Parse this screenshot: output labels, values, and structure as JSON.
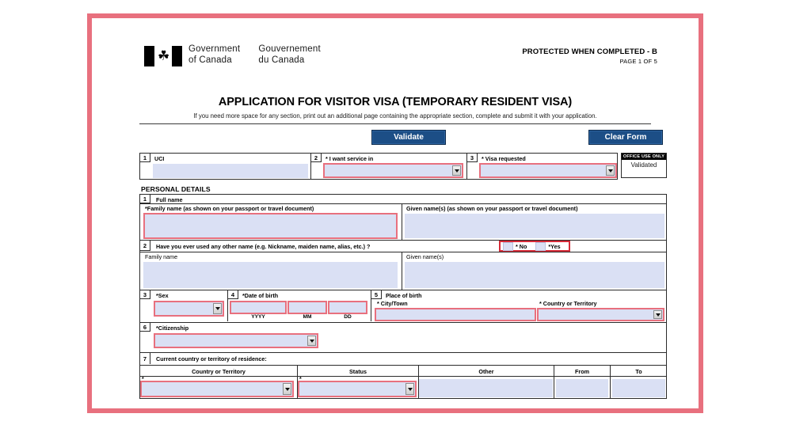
{
  "document": {
    "protected_notice": "PROTECTED WHEN COMPLETED - B",
    "page_indicator": "PAGE 1 OF 5",
    "wordmark_en": "Government of Canada",
    "wordmark_fr": "Gouvernement du Canada",
    "wordmark_en_line1": "Government",
    "wordmark_en_line2": "of Canada",
    "wordmark_fr_line1": "Gouvernement",
    "wordmark_fr_line2": "du Canada",
    "title": "APPLICATION FOR VISITOR VISA (TEMPORARY RESIDENT VISA)",
    "subtitle": "If you need more space for any section, print out an additional page containing the appropriate section, complete and submit it with your application.",
    "maple_leaf": "☘"
  },
  "toolbar": {
    "validate_label": "Validate",
    "clear_label": "Clear Form"
  },
  "top_row": {
    "uci": {
      "number": "1",
      "label": "UCI",
      "value": ""
    },
    "service_in": {
      "number": "2",
      "label": "* I want service in",
      "value": "",
      "required": true
    },
    "visa_requested": {
      "number": "3",
      "label": "* Visa requested",
      "value": "",
      "required": true
    },
    "office_use": {
      "header": "OFFICE USE ONLY",
      "value": "Validated"
    }
  },
  "personal_details": {
    "section_title": "PERSONAL DETAILS",
    "full_name": {
      "number": "1",
      "label": "Full name",
      "family_name_label": "*Family name (as shown on your passport or travel document)",
      "family_name_value": "",
      "given_name_label": "Given name(s)  (as shown on your passport or travel document)",
      "given_name_value": ""
    },
    "other_name": {
      "number": "2",
      "question": "Have you ever used any other name (e.g. Nickname, maiden name, alias, etc.) ?",
      "option_no": "* No",
      "option_yes": "*Yes",
      "family_name_label": "Family name",
      "family_name_value": "",
      "given_name_label": "Given name(s)",
      "given_name_value": ""
    },
    "sex": {
      "number": "3",
      "label": "*Sex",
      "value": ""
    },
    "date_of_birth": {
      "number": "4",
      "label": "*Date of birth",
      "yyyy_caption": "YYYY",
      "mm_caption": "MM",
      "dd_caption": "DD",
      "yyyy_value": "",
      "mm_value": "",
      "dd_value": ""
    },
    "place_of_birth": {
      "number": "5",
      "label": "Place of birth",
      "city_label": "* City/Town",
      "city_value": "",
      "country_label": "* Country or Territory",
      "country_value": ""
    },
    "citizenship": {
      "number": "6",
      "label": "*Citizenship",
      "value": ""
    },
    "residence": {
      "number": "7",
      "label": "Current country or territory of residence:",
      "columns": [
        "Country or Territory",
        "Status",
        "Other",
        "From",
        "To"
      ],
      "row": {
        "country_value": "",
        "status_value": "",
        "other_value": "",
        "from_value": "",
        "to_value": ""
      }
    }
  },
  "colors": {
    "accent_frame": "#e8707e",
    "button_blue": "#1c4e86",
    "field_fill": "#dae0f4",
    "required_border": "#e8707e"
  }
}
